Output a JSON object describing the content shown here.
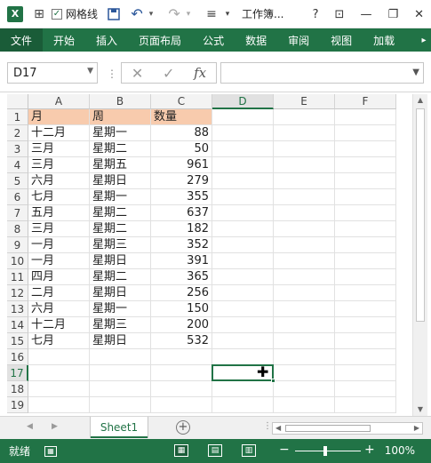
{
  "titlebar": {
    "gridlines_label": "网格线",
    "title": "工作簿...",
    "help": "?",
    "ribbon_display": "⊡",
    "minimize": "—",
    "restore": "❐",
    "close": "✕"
  },
  "ribbon": {
    "tabs": [
      {
        "label": "文件"
      },
      {
        "label": "开始"
      },
      {
        "label": "插入"
      },
      {
        "label": "页面布局"
      },
      {
        "label": "公式"
      },
      {
        "label": "数据"
      },
      {
        "label": "审阅"
      },
      {
        "label": "视图"
      },
      {
        "label": "加载"
      }
    ]
  },
  "formula_bar": {
    "name_box": "D17",
    "formula": "",
    "fx": "fx"
  },
  "sheet": {
    "columns": [
      "A",
      "B",
      "C",
      "D",
      "E",
      "F"
    ],
    "selected_cell": "D17",
    "rows": [
      {
        "n": "1",
        "a": "月",
        "b": "周",
        "c": "数量"
      },
      {
        "n": "2",
        "a": "十二月",
        "b": "星期一",
        "c": "88"
      },
      {
        "n": "3",
        "a": "三月",
        "b": "星期二",
        "c": "50"
      },
      {
        "n": "4",
        "a": "三月",
        "b": "星期五",
        "c": "961"
      },
      {
        "n": "5",
        "a": "六月",
        "b": "星期日",
        "c": "279"
      },
      {
        "n": "6",
        "a": "七月",
        "b": "星期一",
        "c": "355"
      },
      {
        "n": "7",
        "a": "五月",
        "b": "星期二",
        "c": "637"
      },
      {
        "n": "8",
        "a": "三月",
        "b": "星期二",
        "c": "182"
      },
      {
        "n": "9",
        "a": "一月",
        "b": "星期三",
        "c": "352"
      },
      {
        "n": "10",
        "a": "一月",
        "b": "星期日",
        "c": "391"
      },
      {
        "n": "11",
        "a": "四月",
        "b": "星期二",
        "c": "365"
      },
      {
        "n": "12",
        "a": "二月",
        "b": "星期日",
        "c": "256"
      },
      {
        "n": "13",
        "a": "六月",
        "b": "星期一",
        "c": "150"
      },
      {
        "n": "14",
        "a": "十二月",
        "b": "星期三",
        "c": "200"
      },
      {
        "n": "15",
        "a": "七月",
        "b": "星期日",
        "c": "532"
      },
      {
        "n": "16",
        "a": "",
        "b": "",
        "c": ""
      },
      {
        "n": "17",
        "a": "",
        "b": "",
        "c": ""
      },
      {
        "n": "18",
        "a": "",
        "b": "",
        "c": ""
      },
      {
        "n": "19",
        "a": "",
        "b": "",
        "c": ""
      }
    ]
  },
  "sheet_tabs": {
    "active": "Sheet1",
    "add": "+"
  },
  "status": {
    "ready": "就绪",
    "zoom": "100%",
    "zoom_minus": "−",
    "zoom_plus": "+"
  },
  "colors": {
    "accent": "#217346",
    "header_fill": "#f8cbad"
  }
}
